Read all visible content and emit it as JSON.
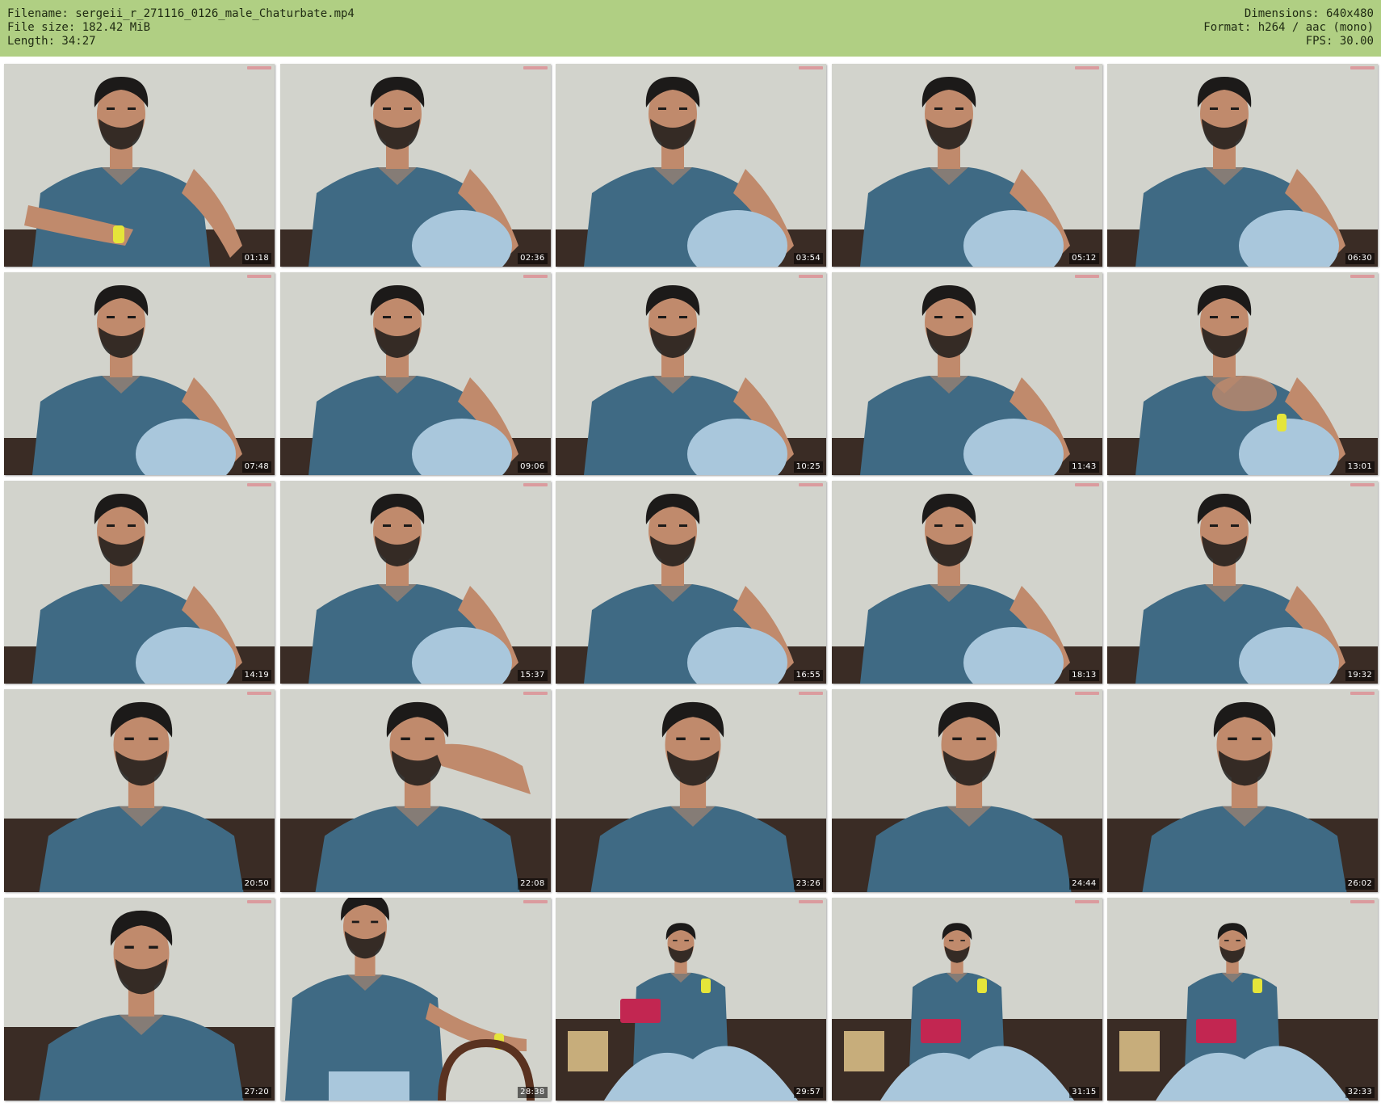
{
  "header": {
    "filename": "Filename: sergeii_r_271116_0126_male_Chaturbate.mp4",
    "filesize": "File size: 182.42 MiB",
    "length": "Length: 34:27",
    "dimensions": "Dimensions: 640x480",
    "format": "Format: h264 / aac (mono)",
    "fps": "FPS: 30.00"
  },
  "colors": {
    "header_bg": "#b0cf83",
    "wall": "#d2d3cc",
    "shirt": "#3f6a84",
    "jeans": "#a9c7dc",
    "skin": "#c08a6c",
    "hair": "#1c1a19",
    "sofa": "#3a2c25",
    "watch": "#e5e53a",
    "tablet": "#c22651"
  },
  "thumbnails": [
    {
      "time": "01:18",
      "scene": "wide-arms-watch"
    },
    {
      "time": "02:36",
      "scene": "knee-up"
    },
    {
      "time": "03:54",
      "scene": "knee-up"
    },
    {
      "time": "05:12",
      "scene": "knee-up"
    },
    {
      "time": "06:30",
      "scene": "knee-up"
    },
    {
      "time": "07:48",
      "scene": "knee-up"
    },
    {
      "time": "09:06",
      "scene": "knee-up"
    },
    {
      "time": "10:25",
      "scene": "knee-up"
    },
    {
      "time": "11:43",
      "scene": "knee-up"
    },
    {
      "time": "13:01",
      "scene": "arm-raised-watch"
    },
    {
      "time": "14:19",
      "scene": "knee-up"
    },
    {
      "time": "15:37",
      "scene": "knee-up"
    },
    {
      "time": "16:55",
      "scene": "knee-up"
    },
    {
      "time": "18:13",
      "scene": "knee-up"
    },
    {
      "time": "19:32",
      "scene": "knee-up"
    },
    {
      "time": "20:50",
      "scene": "closeup"
    },
    {
      "time": "22:08",
      "scene": "closeup-hand-face"
    },
    {
      "time": "23:26",
      "scene": "closeup"
    },
    {
      "time": "24:44",
      "scene": "closeup"
    },
    {
      "time": "26:02",
      "scene": "closeup"
    },
    {
      "time": "27:20",
      "scene": "closeup"
    },
    {
      "time": "28:38",
      "scene": "standing-chair"
    },
    {
      "time": "29:57",
      "scene": "far-tablet-blur"
    },
    {
      "time": "31:15",
      "scene": "far-tablet"
    },
    {
      "time": "32:33",
      "scene": "far-tablet"
    }
  ]
}
